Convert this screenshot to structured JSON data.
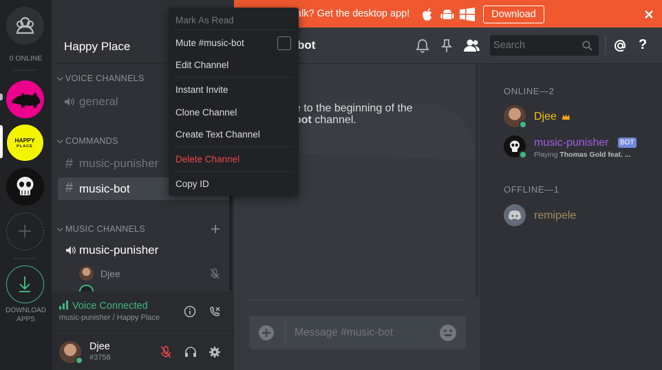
{
  "rail": {
    "online_label": "0 ONLINE",
    "download_label_1": "DOWNLOAD",
    "download_label_2": "APPS",
    "happy_place_icon_text_1": "HAPPY",
    "happy_place_icon_text_2": "PLACE"
  },
  "server": {
    "name": "Happy Place"
  },
  "categories": {
    "voice": "VOICE CHANNELS",
    "commands": "COMMANDS",
    "music": "MUSIC CHANNELS"
  },
  "channels": {
    "general": "general",
    "music_punisher_text": "music-punisher",
    "music_bot": "music-bot",
    "music_punisher_voice": "music-punisher",
    "voice_member": "Djee"
  },
  "voice_panel": {
    "status": "Voice Connected",
    "location": "music-punisher / Happy Place"
  },
  "user": {
    "name": "Djee",
    "tag": "#3758"
  },
  "banner": {
    "text": "alk? Get the desktop app!",
    "download_label": "Download",
    "color": "#f0582f"
  },
  "header": {
    "channel_fragment": "bot",
    "search_placeholder": "Search"
  },
  "chat": {
    "welcome_line_1": "e to the beginning of the",
    "welcome_line_2_bold": "bot",
    "welcome_line_2_rest": " channel.",
    "message_placeholder": "Message #music-bot"
  },
  "members": {
    "online_header": "ONLINE—2",
    "offline_header": "OFFLINE—1",
    "online": [
      {
        "name": "Djee",
        "color": "#f1c40f"
      },
      {
        "name": "music-punisher",
        "color": "#a45de2",
        "badge": "BOT",
        "activity_prefix": "Playing ",
        "activity_game": "Thomas Gold feat. ..."
      }
    ],
    "offline": [
      {
        "name": "remipele",
        "color": "#c9a967"
      }
    ]
  },
  "context_menu": {
    "mark_as_read": "Mark As Read",
    "mute": "Mute #music-bot",
    "edit": "Edit Channel",
    "instant_invite": "Instant Invite",
    "clone": "Clone Channel",
    "create_text": "Create Text Channel",
    "delete": "Delete Channel",
    "copy_id": "Copy ID"
  },
  "colors": {
    "accent_green": "#43b581",
    "danger": "#f04747",
    "bot_badge": "#7289da"
  }
}
